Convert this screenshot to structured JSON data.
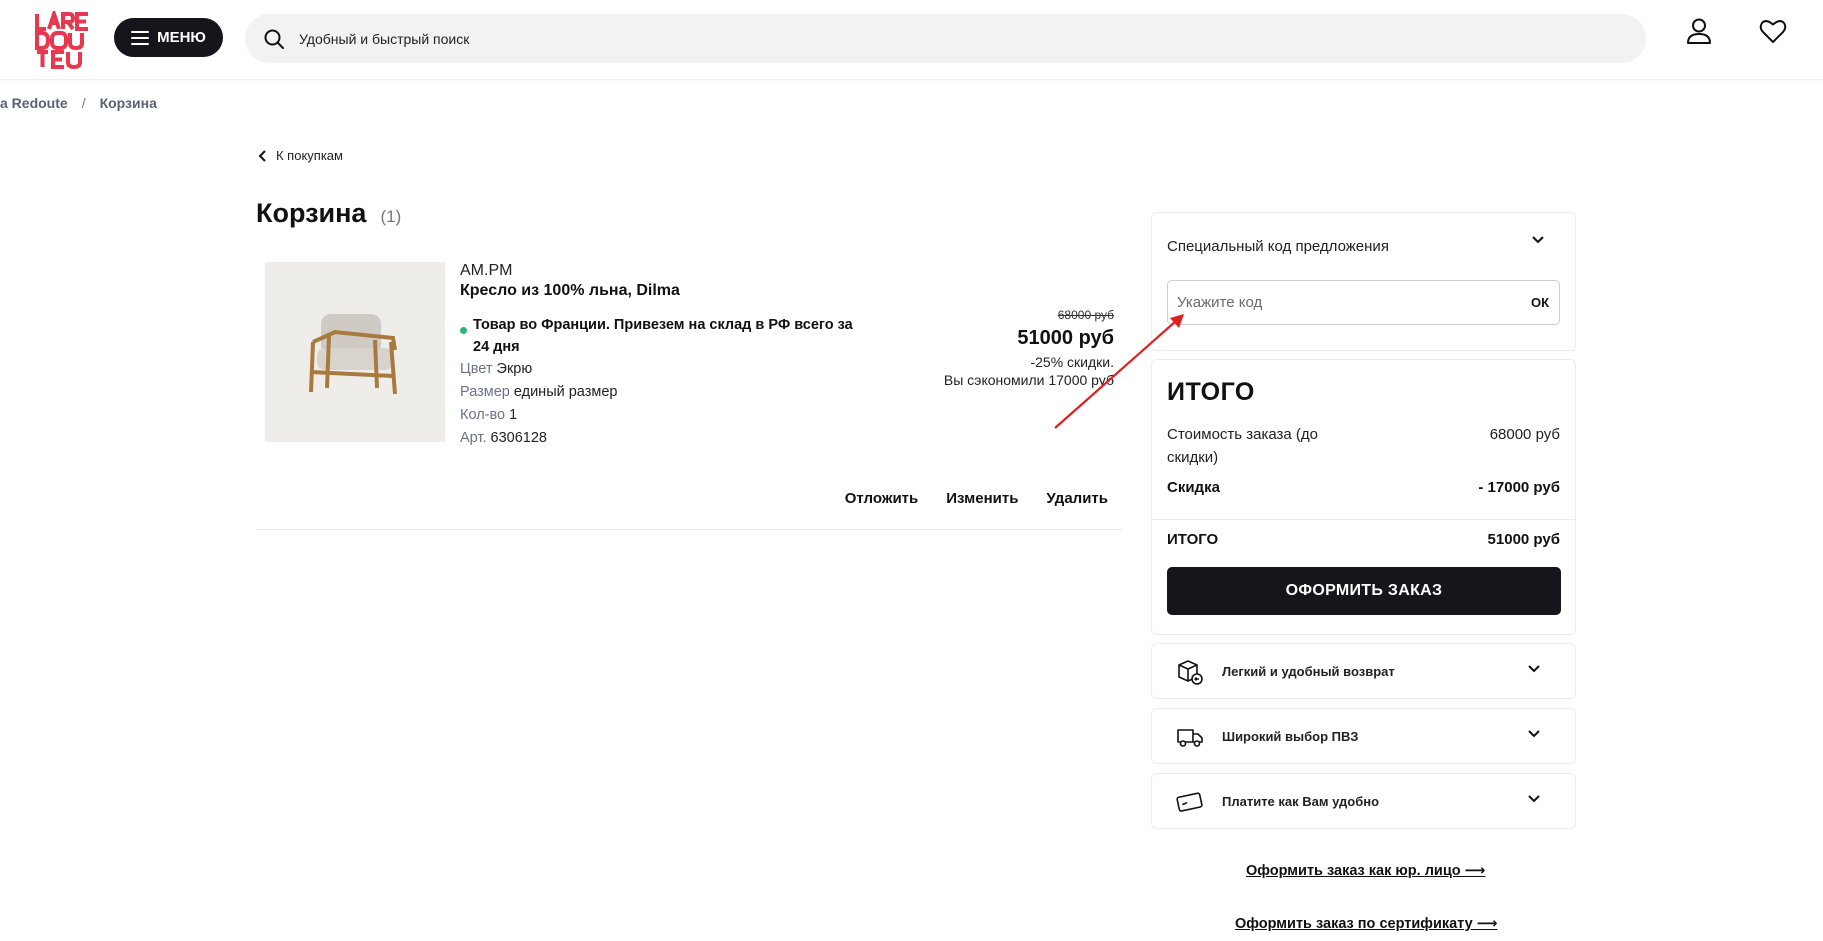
{
  "header": {
    "logo_text": "LA REDOUTE",
    "menu_label": "МЕНЮ",
    "search_placeholder": "Удобный и быстрый поиск"
  },
  "breadcrumb": {
    "items": [
      "a Redoute",
      "Корзина"
    ],
    "separator": "/"
  },
  "back_link": "К покупкам",
  "cart": {
    "title": "Корзина",
    "count": "(1)"
  },
  "product": {
    "brand": "AM.PM",
    "name": "Кресло из 100% льна, Dilma",
    "delivery": "Товар во Франции. Привезем на склад в РФ всего за 24 дня",
    "color_label": "Цвет",
    "color_value": "Экрю",
    "size_label": "Размер",
    "size_value": "единый размер",
    "qty_label": "Кол-во",
    "qty_value": "1",
    "art_label": "Арт.",
    "art_value": "6306128",
    "old_price": "68000 руб",
    "price": "51000 руб",
    "discount": "-25% скидки.",
    "saved": "Вы сэкономили 17000 руб"
  },
  "actions": {
    "postpone": "Отложить",
    "change": "Изменить",
    "delete": "Удалить"
  },
  "promo": {
    "title": "Специальный код предложения",
    "placeholder": "Укажите код",
    "ok": "ОК"
  },
  "summary": {
    "title": "ИТОГО",
    "order_cost_label": "Стоимость заказа (до скидки)",
    "order_cost_value": "68000 руб",
    "discount_label": "Скидка",
    "discount_value": "- 17000 руб",
    "total_label": "ИТОГО",
    "total_value": "51000 руб",
    "checkout": "ОФОРМИТЬ ЗАКАЗ"
  },
  "info": {
    "returns": "Легкий и удобный возврат",
    "pickup": "Широкий выбор ПВЗ",
    "payment": "Платите как Вам удобно"
  },
  "links": {
    "legal": "Оформить заказ как юр. лицо ⟶",
    "certificate": "Оформить заказ по сертификату ⟶"
  },
  "colors": {
    "brand_red": "#e8384f",
    "dark": "#14161c",
    "green_dot": "#2bb673",
    "arrow": "#e02020"
  }
}
